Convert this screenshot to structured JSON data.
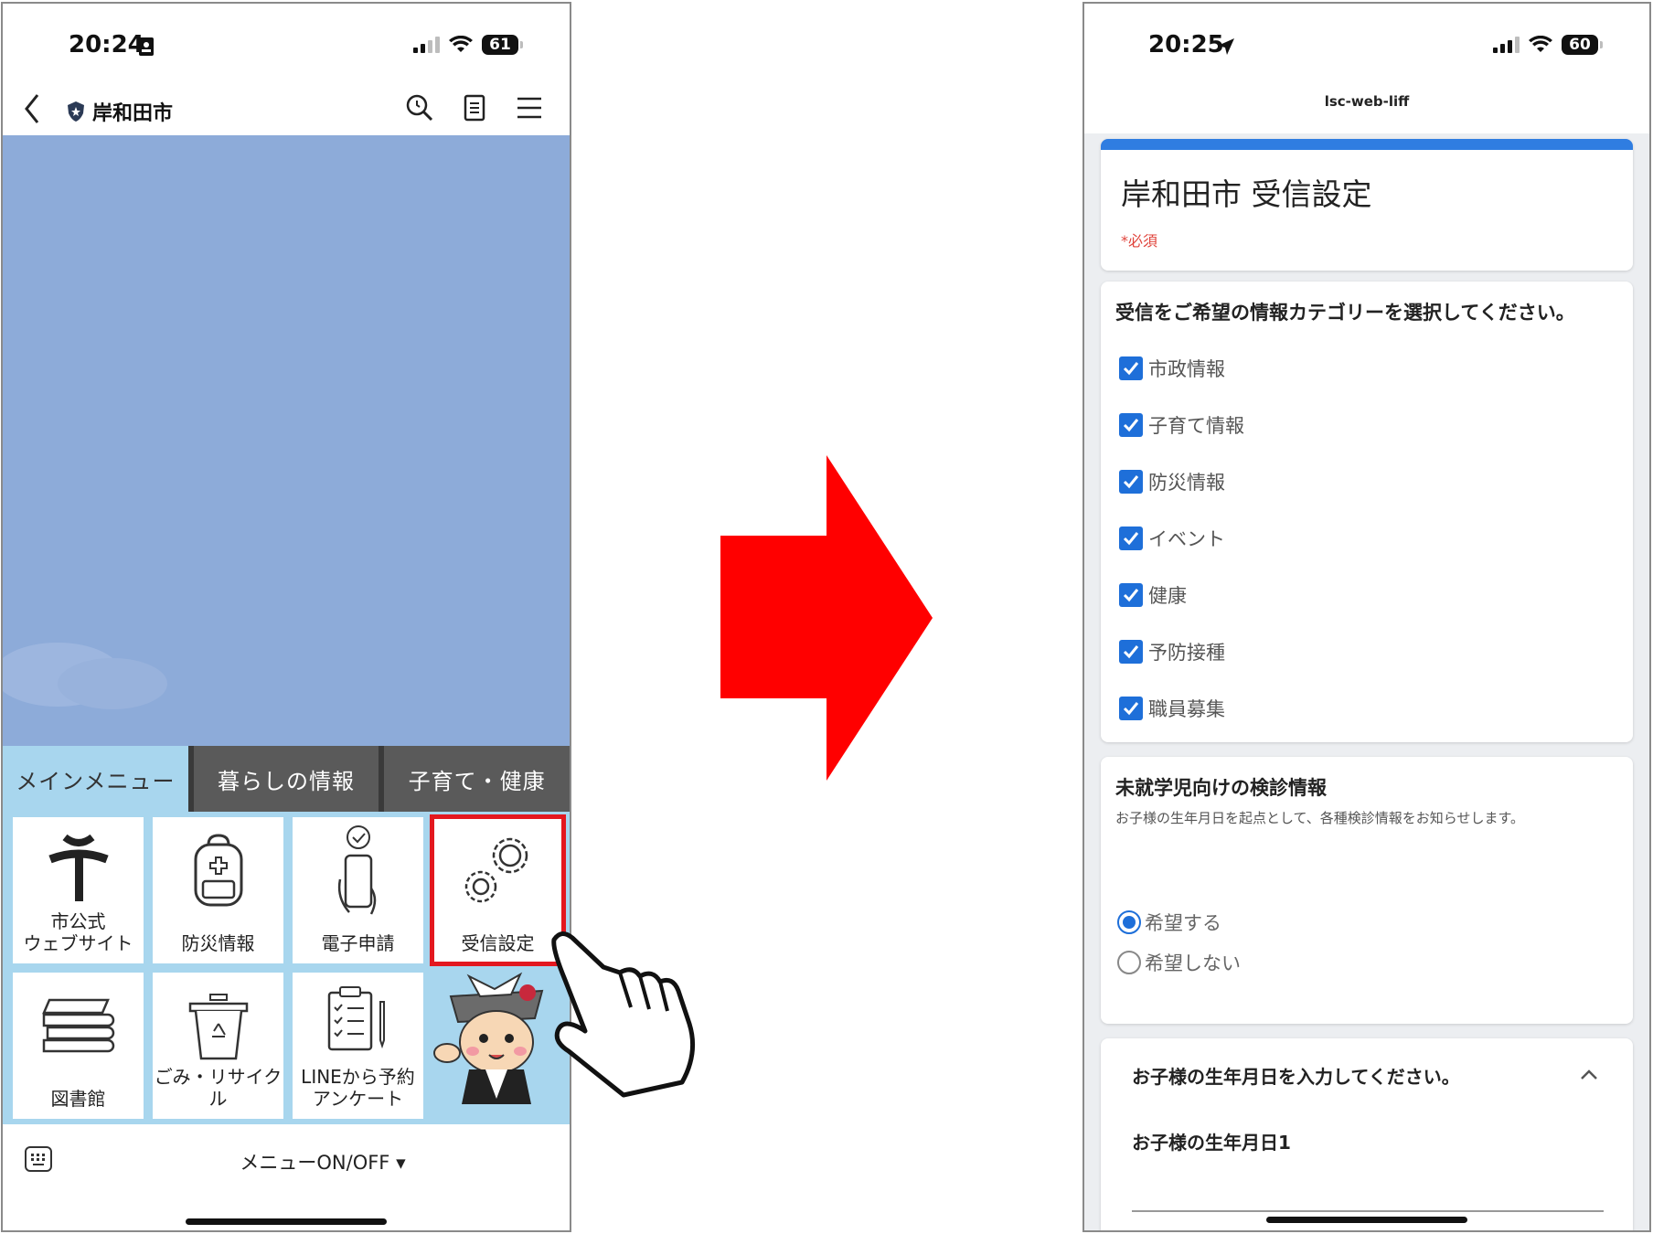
{
  "left_phone": {
    "status": {
      "time": "20:24",
      "battery": "61"
    },
    "header": {
      "title": "岸和田市"
    },
    "menu_tabs": [
      "メインメニュー",
      "暮らしの情報",
      "子育て・健康"
    ],
    "tiles": [
      {
        "label_line1": "市公式",
        "label_line2": "ウェブサイト"
      },
      {
        "label_line1": "防災情報",
        "label_line2": ""
      },
      {
        "label_line1": "電子申請",
        "label_line2": ""
      },
      {
        "label_line1": "受信設定",
        "label_line2": ""
      },
      {
        "label_line1": "図書館",
        "label_line2": ""
      },
      {
        "label_line1": "ごみ・リサイクル",
        "label_line2": ""
      },
      {
        "label_line1": "LINEから予約",
        "label_line2": "アンケート"
      }
    ],
    "menu_toggle": "メニューON/OFF ▾"
  },
  "right_phone": {
    "status": {
      "time": "20:25",
      "battery": "60"
    },
    "url": "lsc-web-liff",
    "form_title": "岸和田市 受信設定",
    "required_note": "*必須",
    "category_question": "受信をご希望の情報カテゴリーを選択してください。",
    "categories": [
      "市政情報",
      "子育て情報",
      "防災情報",
      "イベント",
      "健康",
      "予防接種",
      "職員募集"
    ],
    "checkup_question": {
      "title": "未就学児向けの検診情報",
      "description": "お子様の生年月日を起点として、各種検診情報をお知らせします。",
      "options": [
        "希望する",
        "希望しない"
      ],
      "selected": "希望する"
    },
    "birthday_section": {
      "title": "お子様の生年月日を入力してください。",
      "field_label": "お子様の生年月日1"
    }
  },
  "colors": {
    "chat_bg": "#8dabd9",
    "menu_bg": "#a8d6ee",
    "highlight": "#e3181f",
    "arrow": "#ff0000",
    "form_accent": "#2f7de1",
    "checkbox": "#1e6fd9"
  },
  "icons": [
    "back-icon",
    "shield-icon",
    "search-icon",
    "notes-icon",
    "hamburger-icon",
    "city-emblem-icon",
    "backpack-icon",
    "phone-check-icon",
    "gears-icon",
    "books-icon",
    "recycle-bin-icon",
    "clipboard-icon",
    "keyboard-icon",
    "pointing-hand-icon",
    "chevron-up-icon"
  ]
}
